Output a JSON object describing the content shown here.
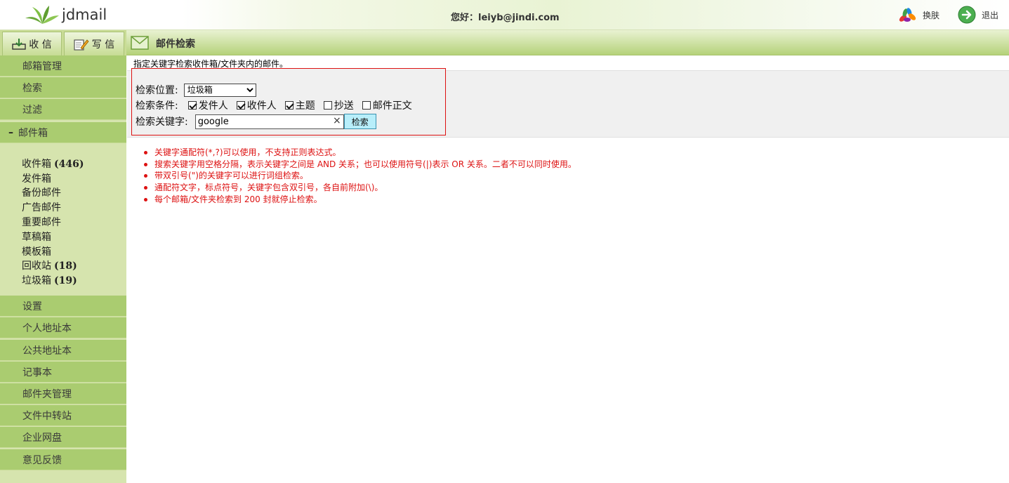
{
  "header": {
    "brand": "jdmail",
    "greeting_label": "您好：",
    "greeting_user": "leiyb@jindi.com",
    "skin_label": "换肤",
    "logout_label": "退出"
  },
  "toolbar": {
    "receive_label": "收 信",
    "write_label": "写 信"
  },
  "page": {
    "title": "邮件检索",
    "description": "指定关键字检索收件箱/文件夹内的邮件。"
  },
  "sidebar": {
    "top_items": [
      "邮箱管理",
      "检索",
      "过滤"
    ],
    "mailbox_header": "邮件箱",
    "mailbox_toggle": "–",
    "folders": [
      {
        "name": "收件箱",
        "count": "(446)"
      },
      {
        "name": "发件箱",
        "count": ""
      },
      {
        "name": "备份邮件",
        "count": ""
      },
      {
        "name": "广告邮件",
        "count": ""
      },
      {
        "name": "重要邮件",
        "count": ""
      },
      {
        "name": "草稿箱",
        "count": ""
      },
      {
        "name": "模板箱",
        "count": ""
      },
      {
        "name": "回收站",
        "count": "(18)"
      },
      {
        "name": "垃圾箱",
        "count": "(19)"
      }
    ],
    "bottom_items": [
      "设置",
      "个人地址本",
      "公共地址本",
      "记事本",
      "邮件夹管理",
      "文件中转站",
      "企业网盘",
      "意见反馈"
    ]
  },
  "search": {
    "location_label": "检索位置:",
    "location_value": "垃圾箱",
    "condition_label": "检索条件:",
    "conditions": [
      {
        "label": "发件人",
        "checked": true
      },
      {
        "label": "收件人",
        "checked": true
      },
      {
        "label": "主题",
        "checked": true
      },
      {
        "label": "抄送",
        "checked": false
      },
      {
        "label": "邮件正文",
        "checked": false
      }
    ],
    "keyword_label": "检索关键字:",
    "keyword_value": "google",
    "clear_symbol": "×",
    "button_label": "检索"
  },
  "tips": [
    "关键字通配符(*,?)可以使用，不支持正则表达式。",
    "搜索关键字用空格分隔，表示关键字之间是 AND 关系；也可以使用符号(|)表示 OR 关系。二者不可以同时使用。",
    "带双引号(\")的关键字可以进行词组检索。",
    "通配符文字，标点符号，关键字包含双引号，各自前附加(\\)。",
    "每个邮箱/文件夹检索到 200 封就停止检索。"
  ]
}
